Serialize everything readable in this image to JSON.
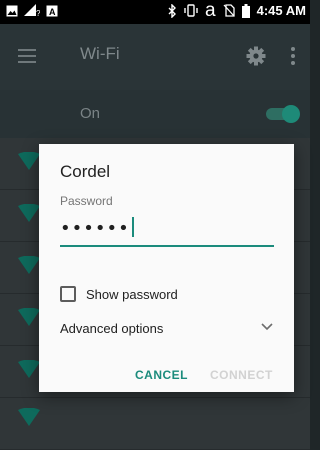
{
  "status_bar": {
    "time": "4:45 AM",
    "carrier_glyph": "a",
    "icons": [
      "image-icon",
      "signal-question-icon",
      "a-box-icon",
      "bluetooth-icon",
      "vibrate-icon",
      "a-icon",
      "no-sim-icon",
      "battery-icon"
    ]
  },
  "app_bar": {
    "title": "Wi-Fi",
    "icons": [
      "menu-icon",
      "gear-icon",
      "more-vert-icon"
    ]
  },
  "master_switch": {
    "label": "On",
    "state": true
  },
  "dialog": {
    "network_name": "Cordel",
    "password_label": "Password",
    "password_value": "••••••",
    "show_password_label": "Show password",
    "show_password_checked": false,
    "advanced_label": "Advanced options",
    "cancel_label": "CANCEL",
    "connect_label": "CONNECT"
  },
  "colors": {
    "accent": "#1b8b7c",
    "app_bar": "#2a3437",
    "dialog_bg": "#fafafa",
    "disabled_text": "#d2d2d2"
  }
}
